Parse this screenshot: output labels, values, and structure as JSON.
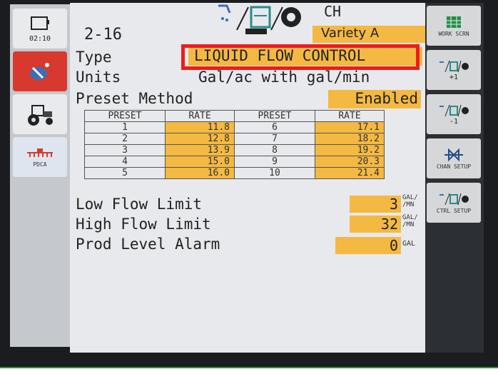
{
  "left_sidebar": {
    "clock": "02:10",
    "pdca_label": "PDCA"
  },
  "header": {
    "title": "2-16",
    "ch_label": "CH",
    "variety": "Variety A"
  },
  "settings": {
    "type_label": "Type",
    "type_value": "LIQUID FLOW CONTROL",
    "units_label": "Units",
    "units_value": "Gal/ac with gal/min",
    "preset_method_label": "Preset Method",
    "preset_method_value": "Enabled"
  },
  "preset_table": {
    "headers": [
      "PRESET",
      "RATE",
      "PRESET",
      "RATE"
    ],
    "rows": [
      [
        "1",
        "11.8",
        "6",
        "17.1"
      ],
      [
        "2",
        "12.8",
        "7",
        "18.2"
      ],
      [
        "3",
        "13.9",
        "8",
        "19.2"
      ],
      [
        "4",
        "15.0",
        "9",
        "20.3"
      ],
      [
        "5",
        "16.0",
        "10",
        "21.4"
      ]
    ]
  },
  "limits": {
    "low_flow_label": "Low Flow Limit",
    "low_flow_value": "3",
    "low_flow_unit_top": "GAL/",
    "low_flow_unit_bottom": "/MN",
    "high_flow_label": "High Flow Limit",
    "high_flow_value": "32",
    "high_flow_unit_top": "GAL/",
    "high_flow_unit_bottom": "/MN",
    "alarm_label": "Prod Level Alarm",
    "alarm_value": "0",
    "alarm_unit": "GAL"
  },
  "right_sidebar": {
    "work_screen_label": "WORK SCRN",
    "plus_one": "+1",
    "minus_one": "-1",
    "chan_setup_label": "CHAN SETUP",
    "ctrl_setup_label": "CTRL SETUP"
  },
  "colors": {
    "highlight": "#f4b942",
    "selection_border": "#ee1c1c",
    "alert_button": "#d8392e"
  }
}
